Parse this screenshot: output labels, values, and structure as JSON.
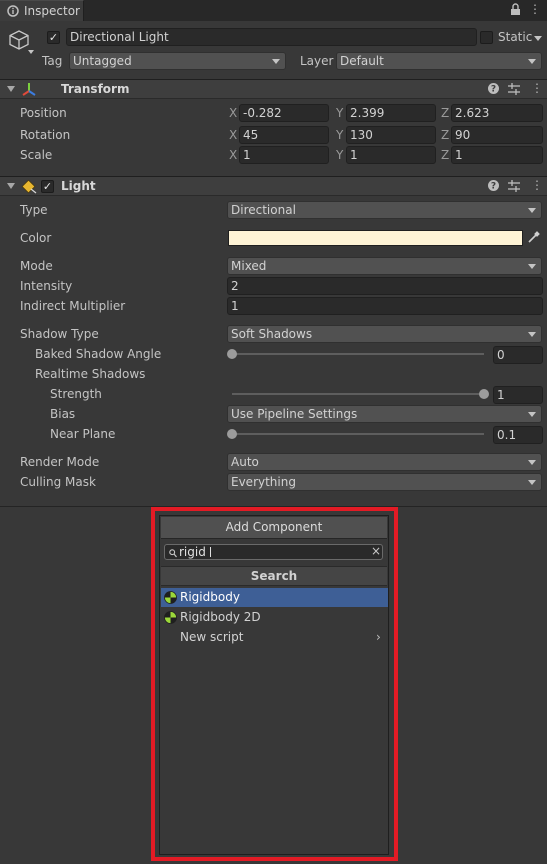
{
  "tab": {
    "title": "Inspector"
  },
  "object": {
    "name": "Directional Light",
    "static_label": "Static",
    "tag_label": "Tag",
    "tag_value": "Untagged",
    "layer_label": "Layer",
    "layer_value": "Default"
  },
  "transform": {
    "title": "Transform",
    "rows": [
      {
        "label": "Position",
        "x": "-0.282",
        "y": "2.399",
        "z": "2.623"
      },
      {
        "label": "Rotation",
        "x": "45",
        "y": "130",
        "z": "90"
      },
      {
        "label": "Scale",
        "x": "1",
        "y": "1",
        "z": "1"
      }
    ],
    "axes": {
      "x": "X",
      "y": "Y",
      "z": "Z"
    }
  },
  "light": {
    "title": "Light",
    "type_label": "Type",
    "type_value": "Directional",
    "color_label": "Color",
    "color_hex": "#fff4d6",
    "mode_label": "Mode",
    "mode_value": "Mixed",
    "intensity_label": "Intensity",
    "intensity_value": "2",
    "indirect_label": "Indirect Multiplier",
    "indirect_value": "1",
    "shadow_type_label": "Shadow Type",
    "shadow_type_value": "Soft Shadows",
    "baked_angle_label": "Baked Shadow Angle",
    "baked_angle_value": "0",
    "baked_angle_fraction": 0,
    "realtime_label": "Realtime Shadows",
    "strength_label": "Strength",
    "strength_value": "1",
    "strength_fraction": 1,
    "bias_label": "Bias",
    "bias_value": "Use Pipeline Settings",
    "near_plane_label": "Near Plane",
    "near_plane_value": "0.1",
    "near_plane_fraction": 0,
    "render_mode_label": "Render Mode",
    "render_mode_value": "Auto",
    "culling_label": "Culling Mask",
    "culling_value": "Everything"
  },
  "popup": {
    "title": "Add Component",
    "search_value": "rigid",
    "section": "Search",
    "items": [
      {
        "label": "Rigidbody",
        "selected": true
      },
      {
        "label": "Rigidbody 2D",
        "selected": false
      },
      {
        "label": "New script",
        "selected": false
      }
    ]
  },
  "colors": {
    "selection": "#3e5f96",
    "highlight": "#e31b25"
  }
}
